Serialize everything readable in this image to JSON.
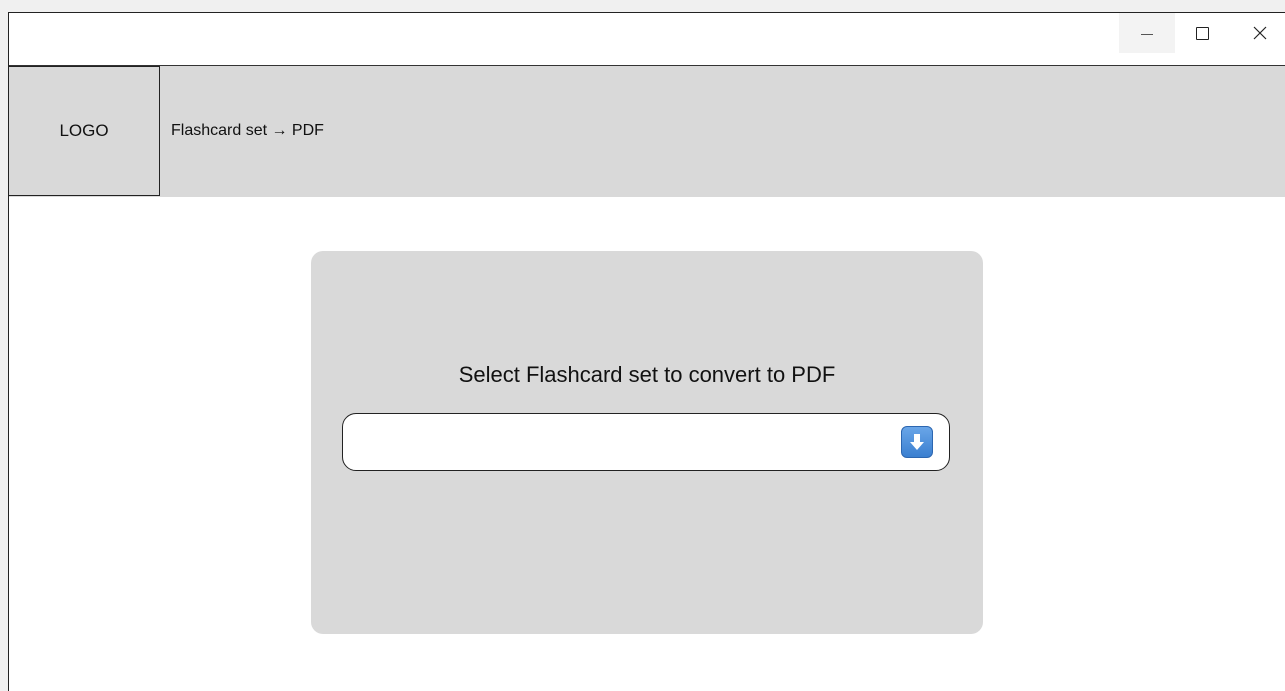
{
  "window": {
    "controls": {
      "minimize_icon": "minimize-icon",
      "maximize_icon": "maximize-icon",
      "close_icon": "close-icon"
    }
  },
  "header": {
    "logo_label": "LOGO",
    "breadcrumb": "Flashcard set → PDF"
  },
  "main": {
    "card_title": "Select Flashcard set to convert to PDF",
    "select": {
      "value": "",
      "icon": "arrow-down-icon"
    }
  },
  "colors": {
    "header_bg": "#d9d9d9",
    "card_bg": "#d9d9d9",
    "dropdown_icon": "#3a7fd0"
  }
}
